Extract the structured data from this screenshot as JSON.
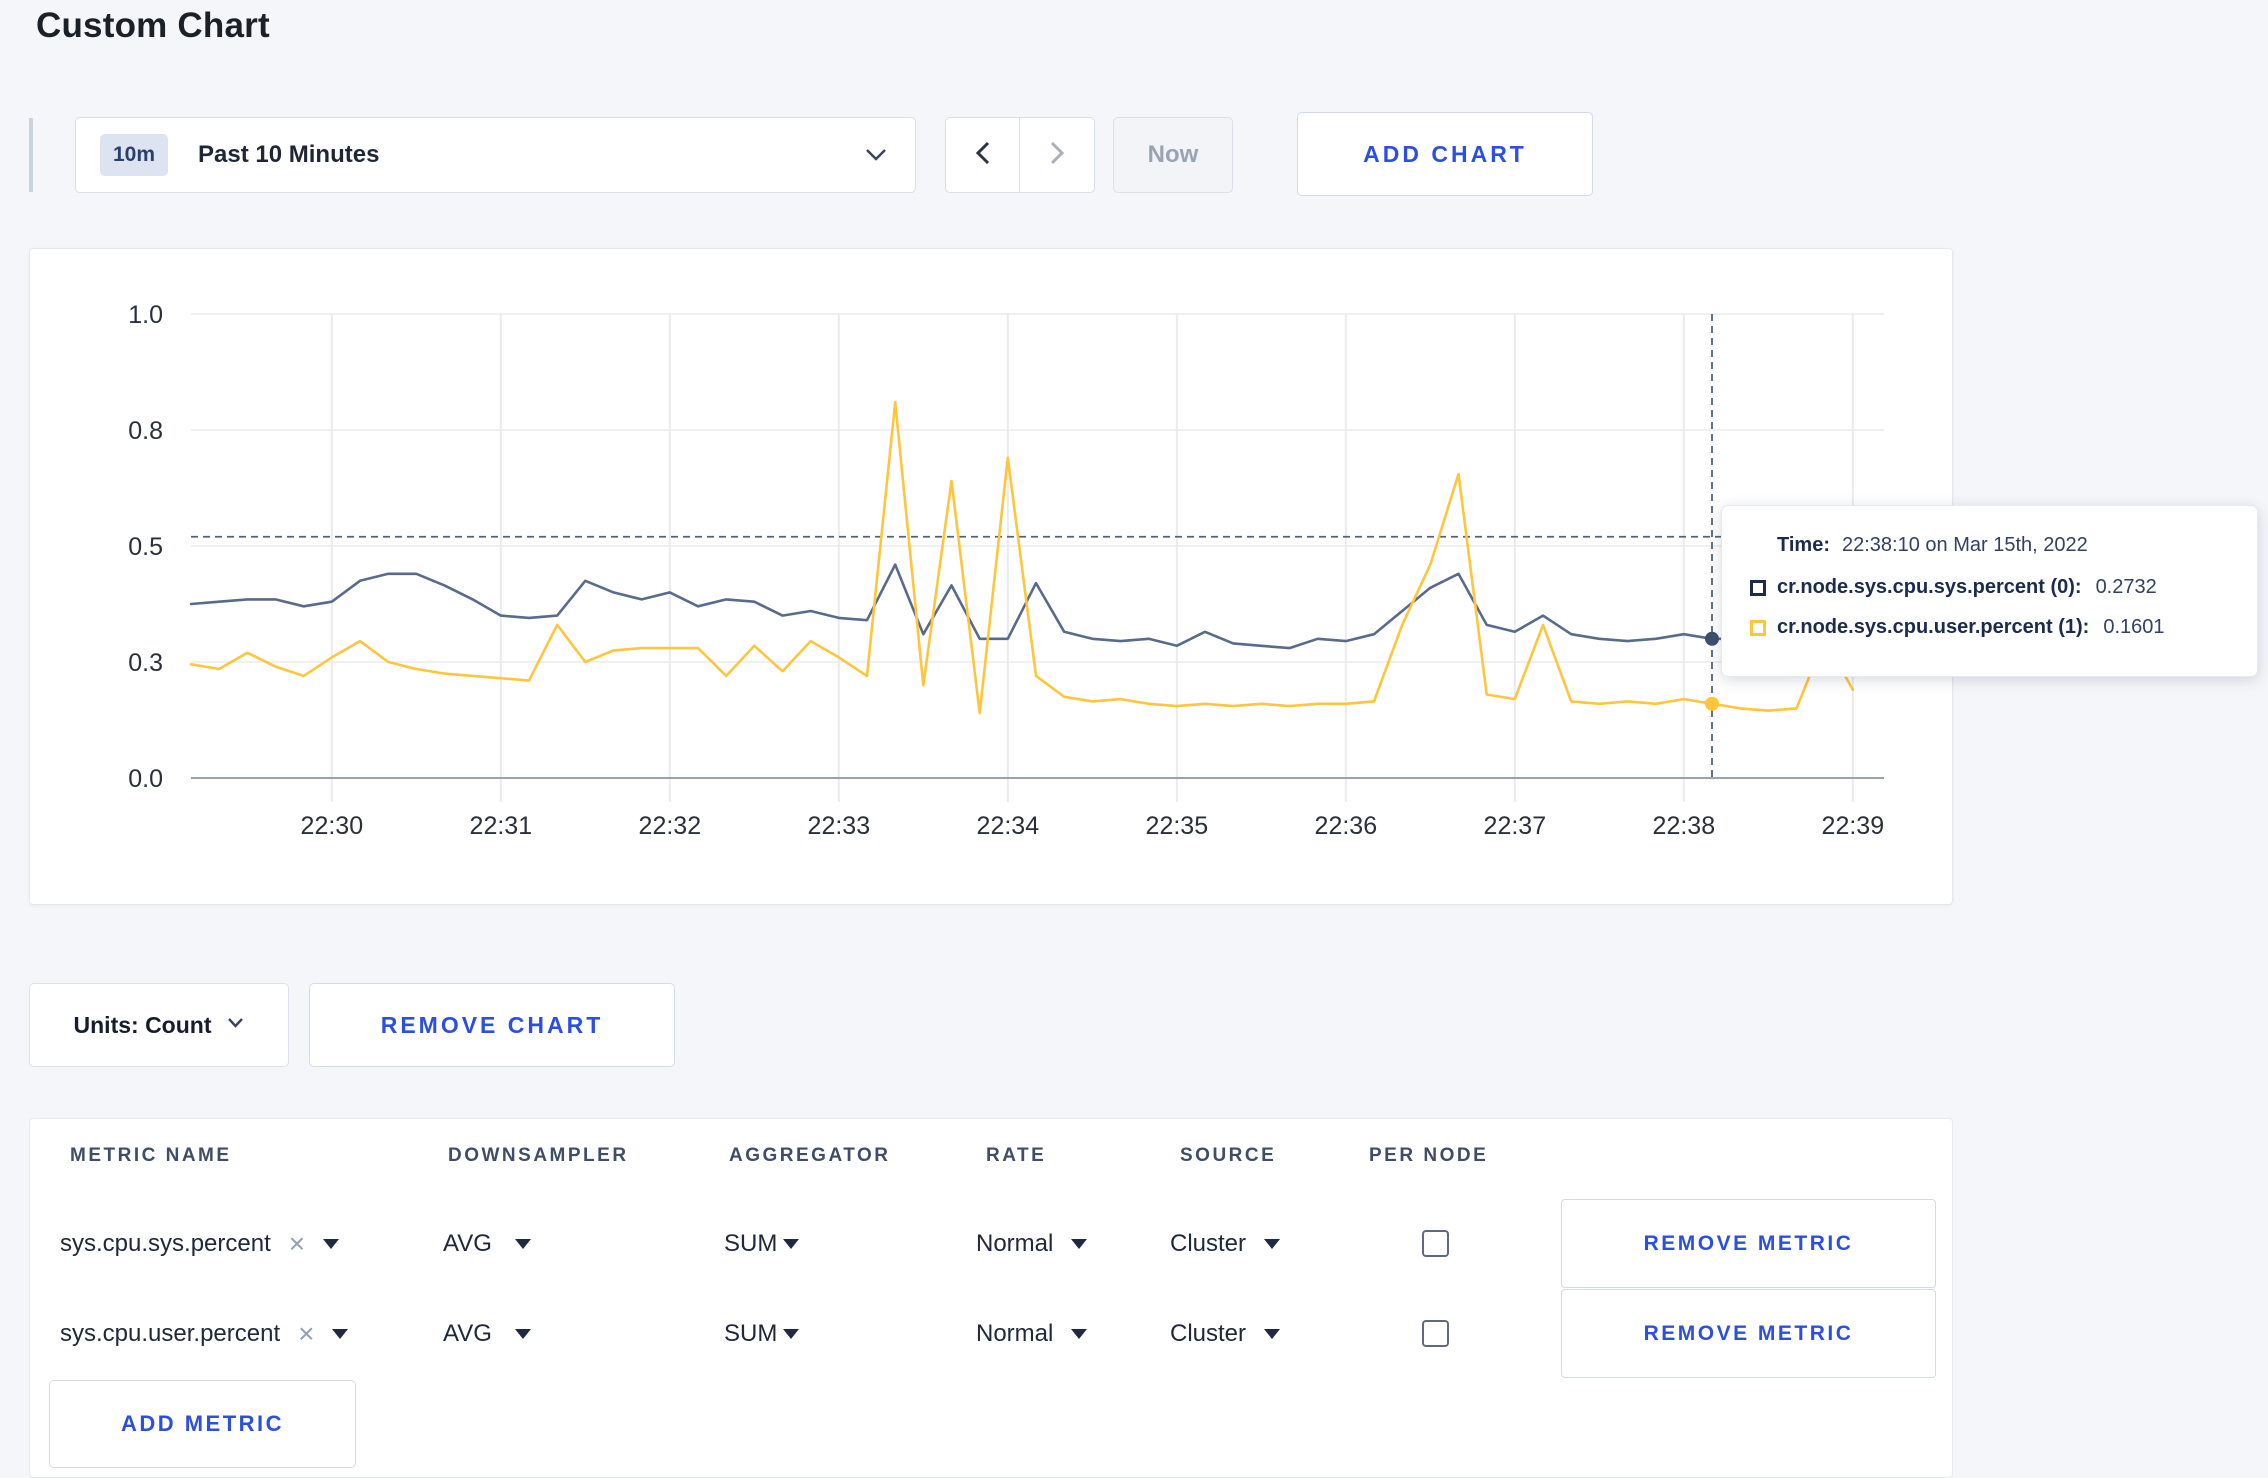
{
  "page": {
    "title": "Custom Chart",
    "background": "#f5f6f9",
    "accent_blue": "#2d4fe0"
  },
  "toolbar": {
    "time_window_badge": "10m",
    "time_window_label": "Past 10 Minutes",
    "now_label": "Now",
    "add_chart_label": "ADD CHART"
  },
  "controls": {
    "units_label": "Units: Count",
    "remove_chart_label": "REMOVE CHART"
  },
  "tooltip": {
    "time_label": "Time:",
    "time_value": "22:38:10 on Mar 15th, 2022",
    "rows": [
      {
        "swatch_color": "#1b2b4d",
        "label": "cr.node.sys.cpu.sys.percent (0):",
        "value": "0.2732"
      },
      {
        "swatch_color": "#ffc53d",
        "label": "cr.node.sys.cpu.user.percent (1):",
        "value": "0.1601"
      }
    ]
  },
  "chart_data": {
    "type": "line",
    "title": "",
    "xlabel": "",
    "ylabel": "",
    "ylim": [
      0,
      1
    ],
    "grid": true,
    "legend_position": "tooltip-only",
    "x_start_time": "22:29:10",
    "x_end_time": "22:39:10",
    "sample_interval_seconds": 10,
    "x_domain_seconds": 600,
    "x_ticks": [
      {
        "label": "22:30",
        "t": 50
      },
      {
        "label": "22:31",
        "t": 110
      },
      {
        "label": "22:32",
        "t": 170
      },
      {
        "label": "22:33",
        "t": 230
      },
      {
        "label": "22:34",
        "t": 290
      },
      {
        "label": "22:35",
        "t": 350
      },
      {
        "label": "22:36",
        "t": 410
      },
      {
        "label": "22:37",
        "t": 470
      },
      {
        "label": "22:38",
        "t": 530
      },
      {
        "label": "22:39",
        "t": 590
      }
    ],
    "y_ticks": [
      {
        "value": 0.0,
        "label": "0.0"
      },
      {
        "value": 0.25,
        "label": "0.3"
      },
      {
        "value": 0.5,
        "label": "0.5"
      },
      {
        "value": 0.75,
        "label": "0.8"
      },
      {
        "value": 1.0,
        "label": "1.0"
      }
    ],
    "hover": {
      "index": 54,
      "time": "22:38:10",
      "t_seconds": 540,
      "guide_y_value": 0.52,
      "sys_value_shown": "0.2732",
      "user_value_shown": "0.1601"
    },
    "series": [
      {
        "name": "cr.node.sys.cpu.sys.percent",
        "color": "#596b8c",
        "values": [
          0.375,
          0.38,
          0.385,
          0.385,
          0.37,
          0.38,
          0.425,
          0.44,
          0.44,
          0.415,
          0.385,
          0.35,
          0.345,
          0.35,
          0.425,
          0.4,
          0.385,
          0.4,
          0.37,
          0.385,
          0.38,
          0.35,
          0.36,
          0.345,
          0.34,
          0.46,
          0.31,
          0.415,
          0.3,
          0.3,
          0.42,
          0.315,
          0.3,
          0.295,
          0.3,
          0.285,
          0.315,
          0.29,
          0.285,
          0.28,
          0.3,
          0.295,
          0.31,
          0.36,
          0.41,
          0.44,
          0.33,
          0.315,
          0.35,
          0.31,
          0.3,
          0.295,
          0.3,
          0.31,
          0.3,
          0.3,
          0.295,
          0.3,
          0.31,
          0.3
        ]
      },
      {
        "name": "cr.node.sys.cpu.user.percent",
        "color": "#ffc53d",
        "values": [
          0.245,
          0.235,
          0.27,
          0.24,
          0.22,
          0.26,
          0.295,
          0.25,
          0.235,
          0.225,
          0.22,
          0.215,
          0.21,
          0.33,
          0.25,
          0.275,
          0.28,
          0.28,
          0.28,
          0.22,
          0.285,
          0.23,
          0.295,
          0.26,
          0.22,
          0.81,
          0.2,
          0.64,
          0.14,
          0.69,
          0.22,
          0.175,
          0.165,
          0.17,
          0.16,
          0.155,
          0.16,
          0.155,
          0.16,
          0.155,
          0.16,
          0.16,
          0.165,
          0.33,
          0.46,
          0.655,
          0.18,
          0.17,
          0.33,
          0.165,
          0.16,
          0.165,
          0.16,
          0.17,
          0.16,
          0.15,
          0.145,
          0.15,
          0.3,
          0.19
        ]
      }
    ]
  },
  "metrics_table": {
    "headers": [
      "METRIC NAME",
      "DOWNSAMPLER",
      "AGGREGATOR",
      "RATE",
      "SOURCE",
      "PER NODE"
    ],
    "rows": [
      {
        "metric_name": "sys.cpu.sys.percent",
        "downsampler": "AVG",
        "aggregator": "SUM",
        "rate": "Normal",
        "source": "Cluster",
        "per_node_checked": false,
        "remove_label": "REMOVE METRIC"
      },
      {
        "metric_name": "sys.cpu.user.percent",
        "downsampler": "AVG",
        "aggregator": "SUM",
        "rate": "Normal",
        "source": "Cluster",
        "per_node_checked": false,
        "remove_label": "REMOVE METRIC"
      }
    ],
    "add_metric_label": "ADD METRIC"
  }
}
